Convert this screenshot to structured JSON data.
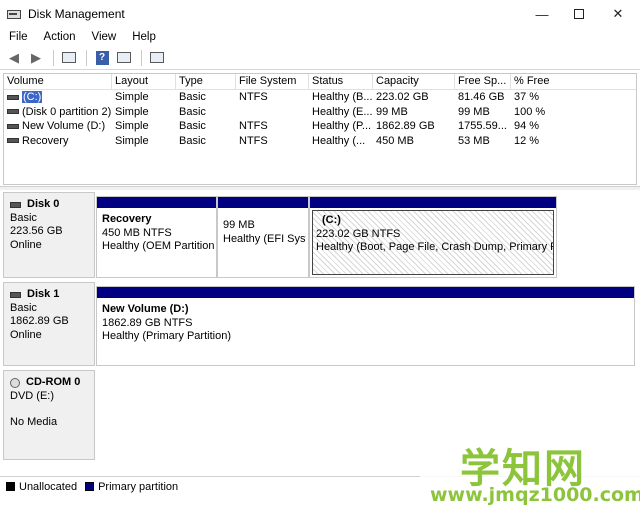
{
  "window": {
    "title": "Disk Management",
    "min_glyph": "—",
    "close_glyph": "✕"
  },
  "menu": [
    "File",
    "Action",
    "View",
    "Help"
  ],
  "toolbar": {
    "back_glyph": "◀",
    "forward_glyph": "▶",
    "help_glyph": "?",
    "icons": [
      "back-arrow-icon",
      "forward-arrow-icon",
      "properties-icon",
      "help-icon",
      "refresh-icon",
      "console-icon"
    ]
  },
  "volume_table": {
    "headers": [
      "Volume",
      "Layout",
      "Type",
      "File System",
      "Status",
      "Capacity",
      "Free Sp...",
      "% Free"
    ],
    "rows": [
      [
        "(C:)",
        "Simple",
        "Basic",
        "NTFS",
        "Healthy (B...",
        "223.02 GB",
        "81.46 GB",
        "37 %"
      ],
      [
        "(Disk 0 partition 2)",
        "Simple",
        "Basic",
        "",
        "Healthy (E...",
        "99 MB",
        "99 MB",
        "100 %"
      ],
      [
        "New Volume (D:)",
        "Simple",
        "Basic",
        "NTFS",
        "Healthy (P...",
        "1862.89 GB",
        "1755.59...",
        "94 %"
      ],
      [
        "Recovery",
        "Simple",
        "Basic",
        "NTFS",
        "Healthy (...",
        "450 MB",
        "53 MB",
        "12 %"
      ]
    ]
  },
  "disks": [
    {
      "name": "Disk 0",
      "type": "Basic",
      "size": "223.56 GB",
      "state": "Online",
      "partitions": [
        {
          "name": "Recovery",
          "size": "450 MB NTFS",
          "status": "Healthy (OEM Partition)"
        },
        {
          "name": "",
          "size": "99 MB",
          "status": "Healthy (EFI Syste"
        },
        {
          "name": "(C:)",
          "size": "223.02 GB NTFS",
          "status": "Healthy (Boot, Page File, Crash Dump, Primary Partit"
        }
      ]
    },
    {
      "name": "Disk 1",
      "type": "Basic",
      "size": "1862.89 GB",
      "state": "Online",
      "partitions": [
        {
          "name": "New Volume  (D:)",
          "size": "1862.89 GB NTFS",
          "status": "Healthy (Primary Partition)"
        }
      ]
    },
    {
      "name": "CD-ROM 0",
      "type": "DVD (E:)",
      "size": "",
      "state": "No Media",
      "partitions": []
    }
  ],
  "legend": [
    {
      "label": "Unallocated",
      "color": "#000000"
    },
    {
      "label": "Primary partition",
      "color": "#000080"
    }
  ],
  "watermark": {
    "text": "学知网",
    "url": "www.jmqz1000.com"
  },
  "colors": {
    "primary_partition": "#000080",
    "selection": "#3c66c8",
    "watermark": "#8cc43c"
  }
}
